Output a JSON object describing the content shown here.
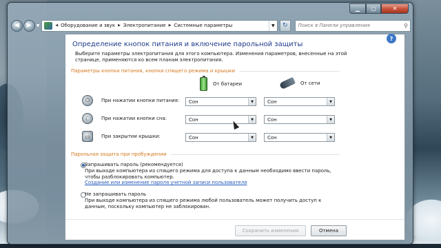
{
  "address": {
    "crumbs": [
      "Оборудование и звук",
      "Электропитание",
      "Системные параметры"
    ]
  },
  "search": {
    "placeholder": "Поиск в Панели управления"
  },
  "page": {
    "title": "Определение кнопок питания и включение парольной защиты",
    "intro": "Выберите параметры электропитания для этого компьютера. Изменения параметров, внесенные на этой странице, применяются ко всем планам электропитания."
  },
  "buttons_section": {
    "heading": "Параметры кнопки питания, кнопки спящего режима и крышки",
    "col_battery": "От батареи",
    "col_ac": "От сети",
    "rows": [
      {
        "label": "При нажатии кнопки питания:",
        "battery": "Сон",
        "ac": "Сон"
      },
      {
        "label": "При нажатии кнопки сна:",
        "battery": "Сон",
        "ac": "Сон"
      },
      {
        "label": "При закрытии крышки:",
        "battery": "Сон",
        "ac": "Сон"
      }
    ]
  },
  "password_section": {
    "heading": "Парольная защита при пробуждении",
    "option1": {
      "title": "Запрашивать пароль (рекомендуется)",
      "desc": "При выходе компьютера из спящего режима для доступа к данным необходимо ввести пароль, чтобы разблокировать компьютер.",
      "link": "Создание или изменение пароля учетной записи пользователя",
      "selected": true
    },
    "option2": {
      "title": "Не запрашивать пароль",
      "desc": "При выходе компьютера из спящего режима любой пользователь может получить доступ к данным, поскольку компьютер не заблокирован.",
      "selected": false
    }
  },
  "footer": {
    "save_label": "Сохранить изменения",
    "cancel_label": "Отмена"
  },
  "colors": {
    "title_blue": "#1e3b8a",
    "section_orange": "#d4761b",
    "link_blue": "#1f57b8"
  }
}
